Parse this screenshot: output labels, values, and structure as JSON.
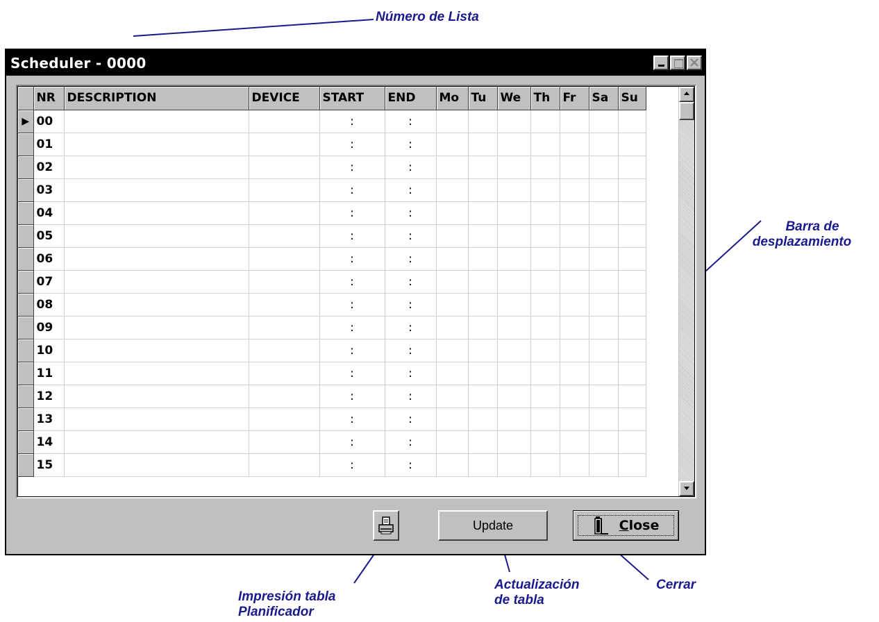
{
  "annotations": {
    "list_number": "Número de Lista",
    "scrollbar_line1": "Barra de",
    "scrollbar_line2": "desplazamiento",
    "print_line1": "Impresión tabla",
    "print_line2": "Planificador",
    "update_line1": "Actualización",
    "update_line2": "de tabla",
    "close": "Cerrar"
  },
  "window": {
    "title": "Scheduler - 0000",
    "controls": [
      "minimize-icon",
      "maximize-icon",
      "close-icon"
    ]
  },
  "grid": {
    "columns": [
      "NR",
      "DESCRIPTION",
      "DEVICE",
      "START",
      "END",
      "Mo",
      "Tu",
      "We",
      "Th",
      "Fr",
      "Sa",
      "Su"
    ],
    "current_row_marker": "▶",
    "time_separator": ":",
    "rows": [
      {
        "nr": "00",
        "description": "",
        "device": "",
        "start": ":",
        "end": ":"
      },
      {
        "nr": "01",
        "description": "",
        "device": "",
        "start": ":",
        "end": ":"
      },
      {
        "nr": "02",
        "description": "",
        "device": "",
        "start": ":",
        "end": ":"
      },
      {
        "nr": "03",
        "description": "",
        "device": "",
        "start": ":",
        "end": ":"
      },
      {
        "nr": "04",
        "description": "",
        "device": "",
        "start": ":",
        "end": ":"
      },
      {
        "nr": "05",
        "description": "",
        "device": "",
        "start": ":",
        "end": ":"
      },
      {
        "nr": "06",
        "description": "",
        "device": "",
        "start": ":",
        "end": ":"
      },
      {
        "nr": "07",
        "description": "",
        "device": "",
        "start": ":",
        "end": ":"
      },
      {
        "nr": "08",
        "description": "",
        "device": "",
        "start": ":",
        "end": ":"
      },
      {
        "nr": "09",
        "description": "",
        "device": "",
        "start": ":",
        "end": ":"
      },
      {
        "nr": "10",
        "description": "",
        "device": "",
        "start": ":",
        "end": ":"
      },
      {
        "nr": "11",
        "description": "",
        "device": "",
        "start": ":",
        "end": ":"
      },
      {
        "nr": "12",
        "description": "",
        "device": "",
        "start": ":",
        "end": ":"
      },
      {
        "nr": "13",
        "description": "",
        "device": "",
        "start": ":",
        "end": ":"
      },
      {
        "nr": "14",
        "description": "",
        "device": "",
        "start": ":",
        "end": ":"
      },
      {
        "nr": "15",
        "description": "",
        "device": "",
        "start": ":",
        "end": ":"
      }
    ]
  },
  "buttons": {
    "print_icon": "printer-icon",
    "update_label": "Update",
    "close_label_underlined": "C",
    "close_label_rest": "lose",
    "close_icon": "door-exit-icon"
  },
  "colors": {
    "annotation": "#1a1a8c",
    "titlebar": "#000000",
    "window_face": "#c0c0c0"
  }
}
